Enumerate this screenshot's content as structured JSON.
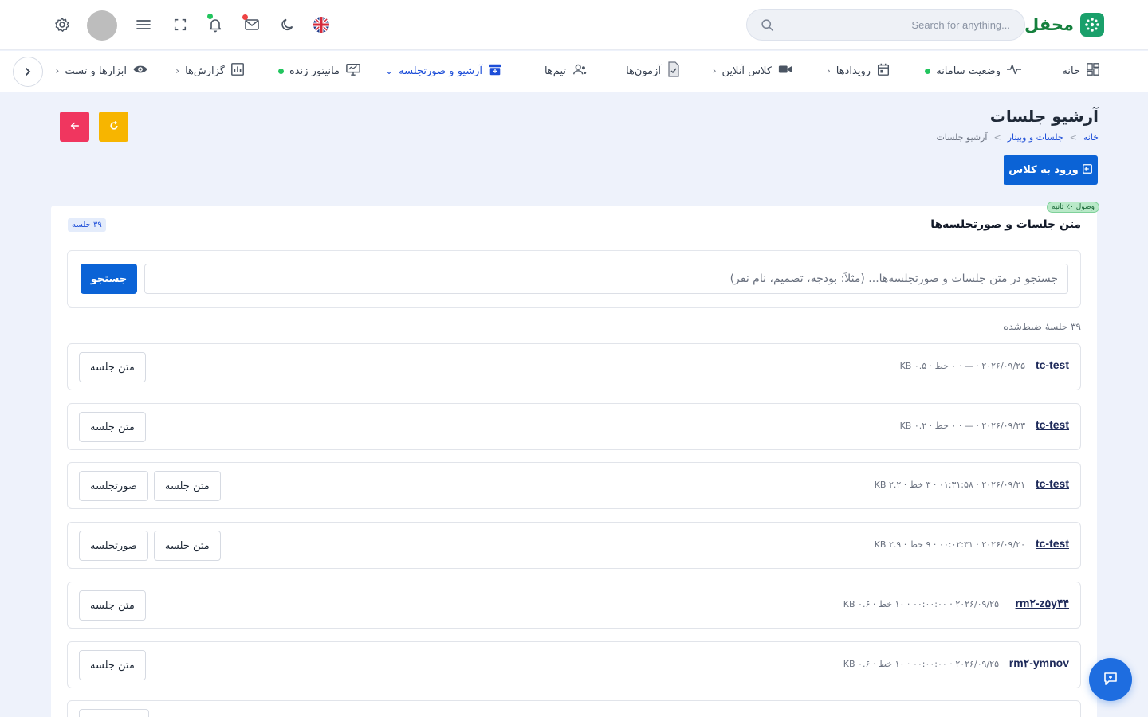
{
  "brand": {
    "name": "محفل"
  },
  "header": {
    "search_placeholder": "Search for anything...",
    "notification_dot_color": "#22c55e",
    "mail_dot_color": "#ef4444"
  },
  "nav": {
    "home": "خانه",
    "system_status": "وضعیت سامانه",
    "events": "رویدادها",
    "online_class": "کلاس آنلاین",
    "exams": "آزمون‌ها",
    "teams": "تیم‌ها",
    "archive": "آرشیو و صورتجلسه",
    "live_monitor": "مانیتور زنده",
    "reports": "گزارش‌ها",
    "tools": "ابزارها و تست"
  },
  "page": {
    "title": "آرشیو جلسات",
    "breadcrumb": [
      "خانه",
      "جلسات و وبینار",
      "آرشیو جلسات"
    ],
    "join_button": "ورود به کلاس"
  },
  "card": {
    "pill": "وصول ۰٪ ثانیه",
    "title": "متن جلسات و صورتجلسه‌ها",
    "count_badge": "۳۹ جلسه",
    "search_placeholder": "جستجو در متن جلسات و صورتجلسه‌ها... (مثلاً: بودجه، تصمیم، نام نفر)",
    "search_button": "جستجو",
    "recorded_count": "۳۹ جلسهٔ ضبط‌شده"
  },
  "sessions": [
    {
      "name": "tc-test",
      "meta": "۲۰۲۶/۰۹/۲۵ · — · ۰ خط · ۰.۵ KB",
      "buttons": [
        "متن جلسه"
      ]
    },
    {
      "name": "tc-test",
      "meta": "۲۰۲۶/۰۹/۲۳ · — · ۰ خط · ۰.۲ KB",
      "buttons": [
        "متن جلسه"
      ]
    },
    {
      "name": "tc-test",
      "meta": "۲۰۲۶/۰۹/۲۱ · ۰۱:۳۱:۵۸ · ۳ خط · ۲.۲ KB",
      "buttons": [
        "متن جلسه",
        "صورتجلسه"
      ]
    },
    {
      "name": "tc-test",
      "meta": "۲۰۲۶/۰۹/۲۰ · ۰۰:۰۲:۳۱ · ۹ خط · ۲.۹ KB",
      "buttons": [
        "متن جلسه",
        "صورتجلسه"
      ]
    },
    {
      "name": "rm۲-z۵y۴۴",
      "meta": "۲۰۲۶/۰۹/۲۵ · ۰۰:۰۰:۰۰ · ۱۰ خط · ۰.۶ KB",
      "buttons": [
        "متن جلسه"
      ]
    },
    {
      "name": "rm۲-ymnov",
      "meta": "۲۰۲۶/۰۹/۲۵ · ۰۰:۰۰:۰۰ · ۱۰ خط · ۰.۶ KB",
      "buttons": [
        "متن جلسه"
      ]
    },
    {
      "name": "",
      "meta": "",
      "buttons": [
        ""
      ]
    }
  ],
  "colors": {
    "primary": "#0b63d6",
    "danger": "#f0365f",
    "warning": "#f7b500",
    "brand": "#15803d"
  }
}
